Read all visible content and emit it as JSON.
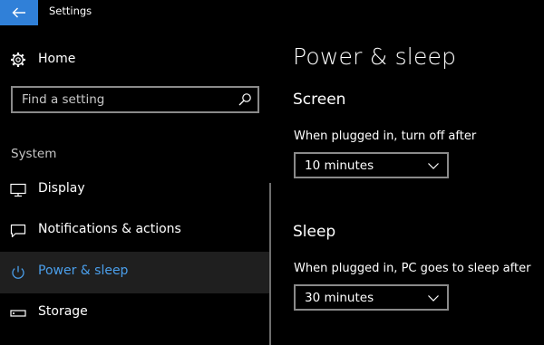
{
  "window": {
    "title": "Settings"
  },
  "sidebar": {
    "home_label": "Home",
    "search_placeholder": "Find a setting",
    "section_label": "System",
    "items": [
      {
        "label": "Display",
        "icon": "monitor-icon",
        "active": false
      },
      {
        "label": "Notifications & actions",
        "icon": "speech-bubble-icon",
        "active": false
      },
      {
        "label": "Power & sleep",
        "icon": "power-icon",
        "active": true
      },
      {
        "label": "Storage",
        "icon": "storage-icon",
        "active": false
      }
    ]
  },
  "main": {
    "title": "Power & sleep",
    "screen": {
      "heading": "Screen",
      "label": "When plugged in, turn off after",
      "value": "10 minutes"
    },
    "sleep": {
      "heading": "Sleep",
      "label": "When plugged in, PC goes to sleep after",
      "value": "30 minutes"
    }
  },
  "colors": {
    "accent": "#3080d8",
    "active_text": "#4a9eea",
    "background": "#000000",
    "active_bg": "#1f1f1f"
  }
}
